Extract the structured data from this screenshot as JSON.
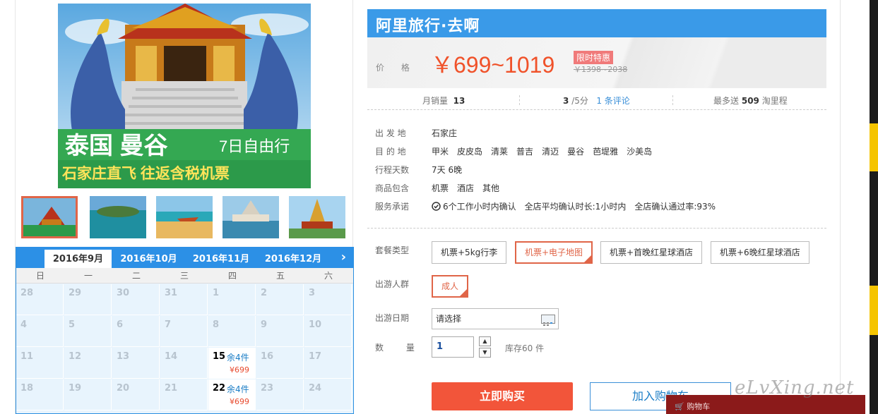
{
  "gallery": {
    "banner_title": "泰国 曼谷",
    "banner_subtitle": "7日自由行",
    "banner_tagline": "石家庄直飞 往返含税机票"
  },
  "calendar": {
    "months": [
      "2016年9月",
      "2016年10月",
      "2016年11月",
      "2016年12月"
    ],
    "active_month": "2016年9月",
    "weekdays": [
      "日",
      "一",
      "二",
      "三",
      "四",
      "五",
      "六"
    ],
    "weeks": [
      [
        {
          "d": "28"
        },
        {
          "d": "29"
        },
        {
          "d": "30"
        },
        {
          "d": "31"
        },
        {
          "d": "1"
        },
        {
          "d": "2"
        },
        {
          "d": "3"
        }
      ],
      [
        {
          "d": "4"
        },
        {
          "d": "5"
        },
        {
          "d": "6"
        },
        {
          "d": "7"
        },
        {
          "d": "8"
        },
        {
          "d": "9"
        },
        {
          "d": "10"
        }
      ],
      [
        {
          "d": "11"
        },
        {
          "d": "12"
        },
        {
          "d": "13"
        },
        {
          "d": "14"
        },
        {
          "d": "15",
          "stock": "余4件",
          "price": "¥699"
        },
        {
          "d": "16"
        },
        {
          "d": "17"
        }
      ],
      [
        {
          "d": "18"
        },
        {
          "d": "19"
        },
        {
          "d": "20"
        },
        {
          "d": "21"
        },
        {
          "d": "22",
          "stock": "余4件",
          "price": "¥699"
        },
        {
          "d": "23"
        },
        {
          "d": "24"
        }
      ]
    ]
  },
  "brand": "阿里旅行·去啊",
  "price": {
    "label": "价 格",
    "range": "￥699~1019",
    "promo_badge": "限时特惠",
    "original": "￥1398~2038"
  },
  "stats": {
    "monthly_sales_label": "月销量",
    "monthly_sales": "13",
    "rating": "3",
    "rating_suffix": "/5分",
    "reviews_link": "1 条评论",
    "miles_prefix": "最多送",
    "miles": "509",
    "miles_suffix": "淘里程"
  },
  "details": [
    {
      "key": "出 发 地",
      "values": [
        "石家庄"
      ]
    },
    {
      "key": "目 的 地",
      "values": [
        "甲米",
        "皮皮岛",
        "清莱",
        "普吉",
        "清迈",
        "曼谷",
        "芭堤雅",
        "沙美岛"
      ]
    },
    {
      "key": "行程天数",
      "values": [
        "7天 6晚"
      ]
    },
    {
      "key": "商品包含",
      "values": [
        "机票",
        "酒店",
        "其他"
      ]
    },
    {
      "key": "服务承诺",
      "values": [
        "6个工作小时内确认",
        "全店平均确认时长:1小时内",
        "全店确认通过率:93%"
      ]
    }
  ],
  "package": {
    "label": "套餐类型",
    "options": [
      "机票+5kg行李",
      "机票+电子地图",
      "机票+首晚红星球酒店",
      "机票+6晚红星球酒店"
    ],
    "selected": "机票+电子地图"
  },
  "travelers": {
    "label": "出游人群",
    "options": [
      "成人"
    ],
    "selected": "成人"
  },
  "date": {
    "label": "出游日期",
    "value": "请选择"
  },
  "quantity": {
    "label": "数 量",
    "value": "1",
    "stock": "库存60 件"
  },
  "actions": {
    "buy": "立即购买",
    "cart": "加入购物车"
  },
  "cart_bar": {
    "label": "购物车"
  },
  "watermark": "eLvXing.net",
  "colors": {
    "brand_blue": "#3a9ae8",
    "price_red": "#f0522a",
    "select_border": "#e06548"
  }
}
